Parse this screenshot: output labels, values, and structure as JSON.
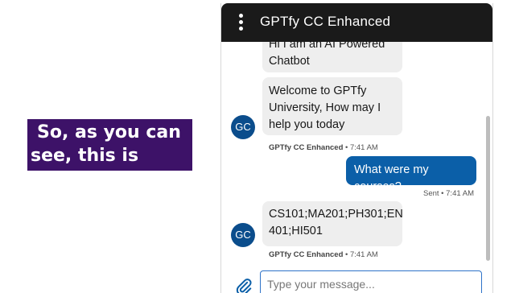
{
  "caption": {
    "line1": "So, as you can",
    "line2": "see, this is"
  },
  "chat": {
    "title": "GPTfy CC Enhanced",
    "messages": [
      {
        "text_line1": "Hi I am an AI Powered",
        "text_line2": "Chatbot"
      },
      {
        "text_line1": "Welcome to GPTfy",
        "text_line2": "University, How may I",
        "text_line3": "help you today",
        "avatar": "GC",
        "sender": "GPTfy CC Enhanced",
        "time": "• 7:41 AM"
      },
      {
        "text": "What were my courses?",
        "status": "Sent • 7:41 AM"
      },
      {
        "text_line1": "CS101;MA201;PH301;EN",
        "text_line2": "401;HI501",
        "avatar": "GC",
        "sender": "GPTfy CC Enhanced",
        "time": "• 7:41 AM"
      }
    ],
    "input_placeholder": "Type your message..."
  },
  "icons": {
    "menu": "vertical-ellipsis-icon",
    "attach": "paperclip-icon"
  },
  "colors": {
    "header": "#1a1a1a",
    "outgoing": "#0b5fa8",
    "avatar": "#0b4d8c",
    "caption_bg": "#3d1268"
  }
}
